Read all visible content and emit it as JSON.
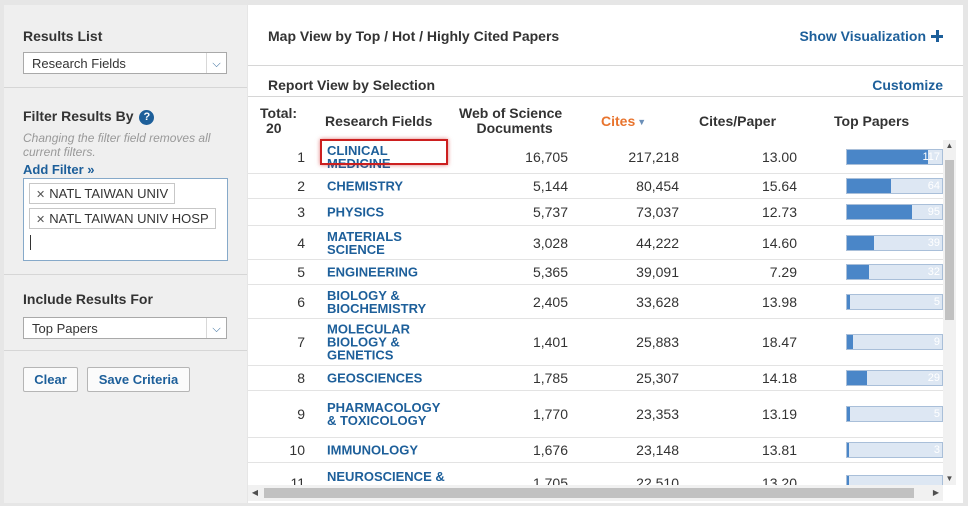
{
  "sidebar": {
    "results_list_title": "Results List",
    "results_list_value": "Research Fields",
    "filter_title": "Filter Results By",
    "filter_help": "?",
    "filter_hint": "Changing the filter field removes all current filters.",
    "add_filter": "Add Filter »",
    "filters": [
      "NATL TAIWAN UNIV",
      "NATL TAIWAN UNIV HOSP"
    ],
    "include_title": "Include Results For",
    "include_value": "Top Papers",
    "clear_label": "Clear",
    "save_label": "Save Criteria"
  },
  "main": {
    "map_title": "Map View by Top / Hot / Highly Cited Papers",
    "show_visualization": "Show Visualization",
    "report_title": "Report View by Selection",
    "customize": "Customize",
    "headers": {
      "total_line1": "Total:",
      "total_line2": "20",
      "research_fields": "Research Fields",
      "wos_line1": "Web of Science",
      "wos_line2": "Documents",
      "cites": "Cites",
      "cites_per_paper": "Cites/Paper",
      "top_papers": "Top Papers"
    },
    "rows": [
      {
        "rank": "1",
        "field": "CLINICAL MEDICINE",
        "docs": "16,705",
        "cites": "217,218",
        "cpp": "13.00",
        "top": "117",
        "top_value": 117
      },
      {
        "rank": "2",
        "field": "CHEMISTRY",
        "docs": "5,144",
        "cites": "80,454",
        "cpp": "15.64",
        "top": "64",
        "top_value": 64
      },
      {
        "rank": "3",
        "field": "PHYSICS",
        "docs": "5,737",
        "cites": "73,037",
        "cpp": "12.73",
        "top": "95",
        "top_value": 95
      },
      {
        "rank": "4",
        "field": "MATERIALS SCIENCE",
        "docs": "3,028",
        "cites": "44,222",
        "cpp": "14.60",
        "top": "39",
        "top_value": 39
      },
      {
        "rank": "5",
        "field": "ENGINEERING",
        "docs": "5,365",
        "cites": "39,091",
        "cpp": "7.29",
        "top": "32",
        "top_value": 32
      },
      {
        "rank": "6",
        "field": "BIOLOGY & BIOCHEMISTRY",
        "docs": "2,405",
        "cites": "33,628",
        "cpp": "13.98",
        "top": "5",
        "top_value": 5
      },
      {
        "rank": "7",
        "field": "MOLECULAR BIOLOGY & GENETICS",
        "docs": "1,401",
        "cites": "25,883",
        "cpp": "18.47",
        "top": "9",
        "top_value": 9
      },
      {
        "rank": "8",
        "field": "GEOSCIENCES",
        "docs": "1,785",
        "cites": "25,307",
        "cpp": "14.18",
        "top": "29",
        "top_value": 29
      },
      {
        "rank": "9",
        "field": "PHARMACOLOGY & TOXICOLOGY",
        "docs": "1,770",
        "cites": "23,353",
        "cpp": "13.19",
        "top": "5",
        "top_value": 5
      },
      {
        "rank": "10",
        "field": "IMMUNOLOGY",
        "docs": "1,676",
        "cites": "23,148",
        "cpp": "13.81",
        "top": "3",
        "top_value": 3
      },
      {
        "rank": "11",
        "field": "NEUROSCIENCE & BEHAVIOR",
        "docs": "1,705",
        "cites": "22,510",
        "cpp": "13.20",
        "top": "",
        "top_value": 0
      }
    ],
    "top_max": 117
  },
  "colors": {
    "link": "#1d5f9a",
    "sort_header": "#e8742e",
    "bar_fill": "#4a86c8",
    "highlight": "#cc1f1f"
  }
}
